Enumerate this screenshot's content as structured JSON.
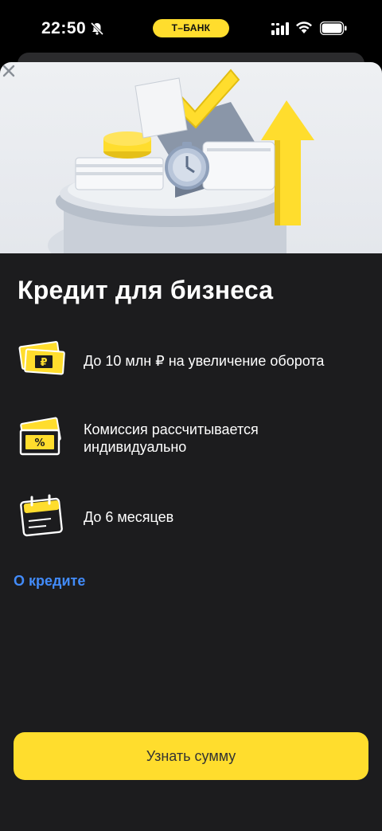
{
  "status_bar": {
    "time": "22:50",
    "carrier_badge": "Т–БАНК",
    "icons": [
      "bell-slash-icon",
      "signal-icon",
      "wifi-icon",
      "battery-icon"
    ]
  },
  "sheet": {
    "title": "Кредит для бизнеса",
    "features": [
      {
        "icon": "money-ruble-icon",
        "text": "До 10 млн ₽ на увеличение оборота"
      },
      {
        "icon": "percent-card-icon",
        "text": "Комиссия рассчитывается индивидуально"
      },
      {
        "icon": "calendar-icon",
        "text": "До 6 месяцев"
      }
    ],
    "link": "О кредите",
    "cta": "Узнать сумму"
  },
  "colors": {
    "accent_yellow": "#ffdd2d",
    "link_blue": "#428bf9",
    "sheet_bg": "#1c1c1e"
  }
}
